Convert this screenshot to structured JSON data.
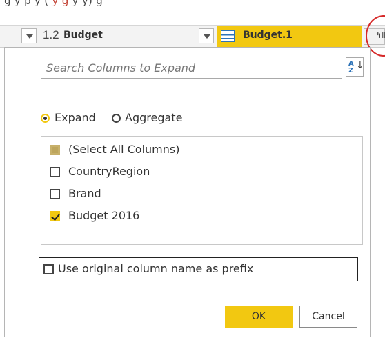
{
  "formula_strip": {
    "text_before": "g        y    p  y  (",
    "text_red": "       y g  ",
    "text_after": "    y          y)     g    "
  },
  "header": {
    "column1": {
      "type_label": "1.2",
      "name": "Budget"
    },
    "column2": {
      "name": "Budget.1",
      "type_icon": "table-icon"
    },
    "expand_button_glyph": "↰ll",
    "highlight_color": "#f2c811"
  },
  "popup": {
    "search": {
      "placeholder": "Search Columns to Expand",
      "value": ""
    },
    "sort_button": {
      "icon": "sort-az-icon",
      "top": "A",
      "bottom": "Z",
      "arrow": "↓"
    },
    "mode": {
      "options": [
        {
          "label": "Expand",
          "selected": true
        },
        {
          "label": "Aggregate",
          "selected": false
        }
      ]
    },
    "columns": [
      {
        "label": "(Select All Columns)",
        "state": "partial"
      },
      {
        "label": "CountryRegion",
        "state": "unchecked"
      },
      {
        "label": "Brand",
        "state": "unchecked"
      },
      {
        "label": "Budget 2016",
        "state": "checked"
      }
    ],
    "use_prefix": {
      "label": "Use original column name as prefix",
      "checked": false
    },
    "buttons": {
      "ok": "OK",
      "cancel": "Cancel"
    }
  },
  "colors": {
    "accent": "#f2c811",
    "annotation_circle": "#d62828"
  }
}
